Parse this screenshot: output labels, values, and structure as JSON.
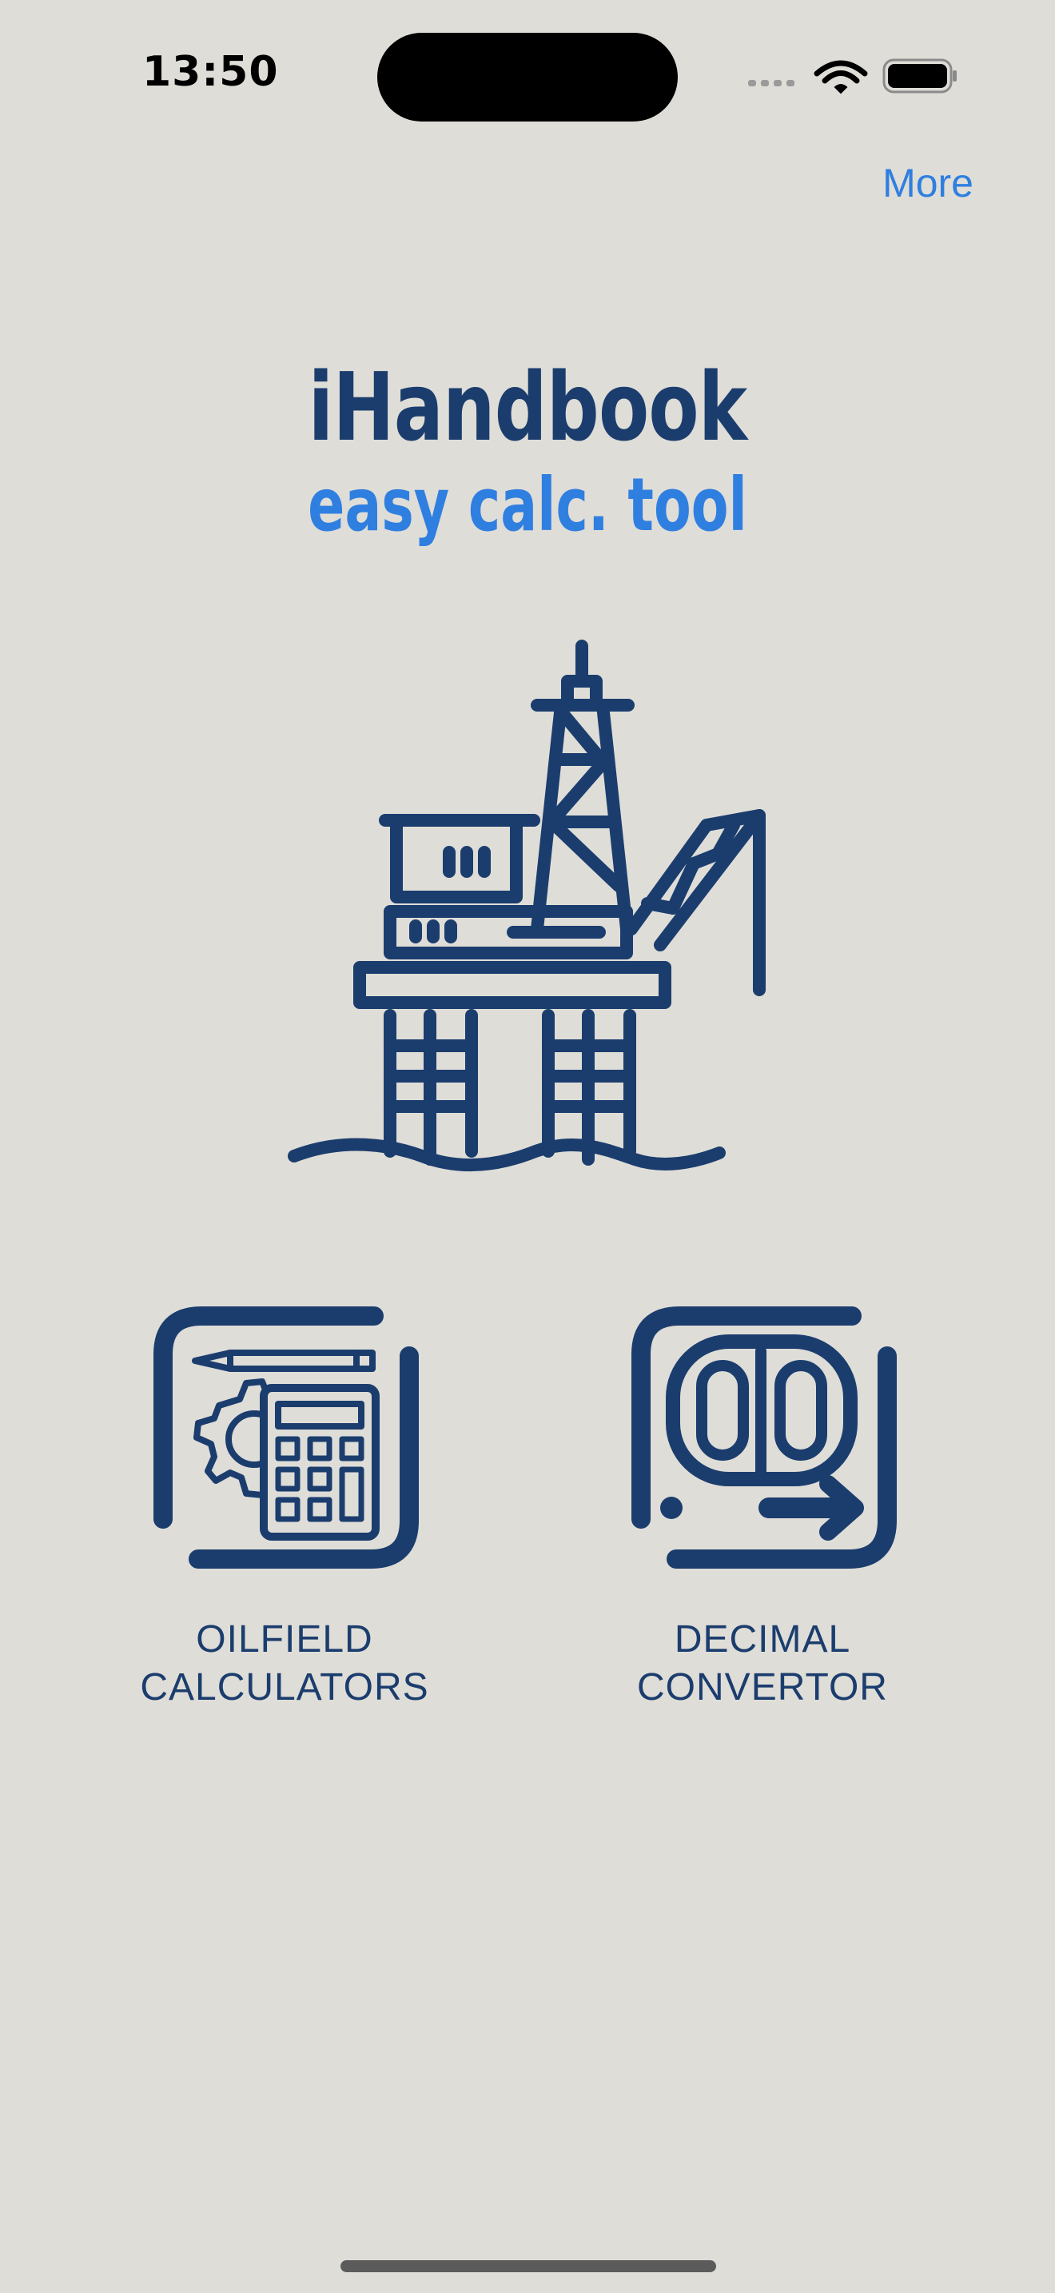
{
  "status_bar": {
    "time": "13:50"
  },
  "nav": {
    "more_label": "More"
  },
  "header": {
    "title": "iHandbook",
    "subtitle": "easy calc. tool"
  },
  "tiles": [
    {
      "label": "OILFIELD\nCALCULATORS",
      "icon": "calculator-icon"
    },
    {
      "label": "DECIMAL\nCONVERTOR",
      "icon": "decimal-convertor-icon"
    }
  ],
  "colors": {
    "background": "#dfddd7",
    "primary": "#1b3d6e",
    "accent": "#2f7fe0"
  },
  "icons": {
    "hero": "oil-rig-icon",
    "status": [
      "cellular-signal-icon",
      "wifi-icon",
      "battery-icon"
    ]
  }
}
